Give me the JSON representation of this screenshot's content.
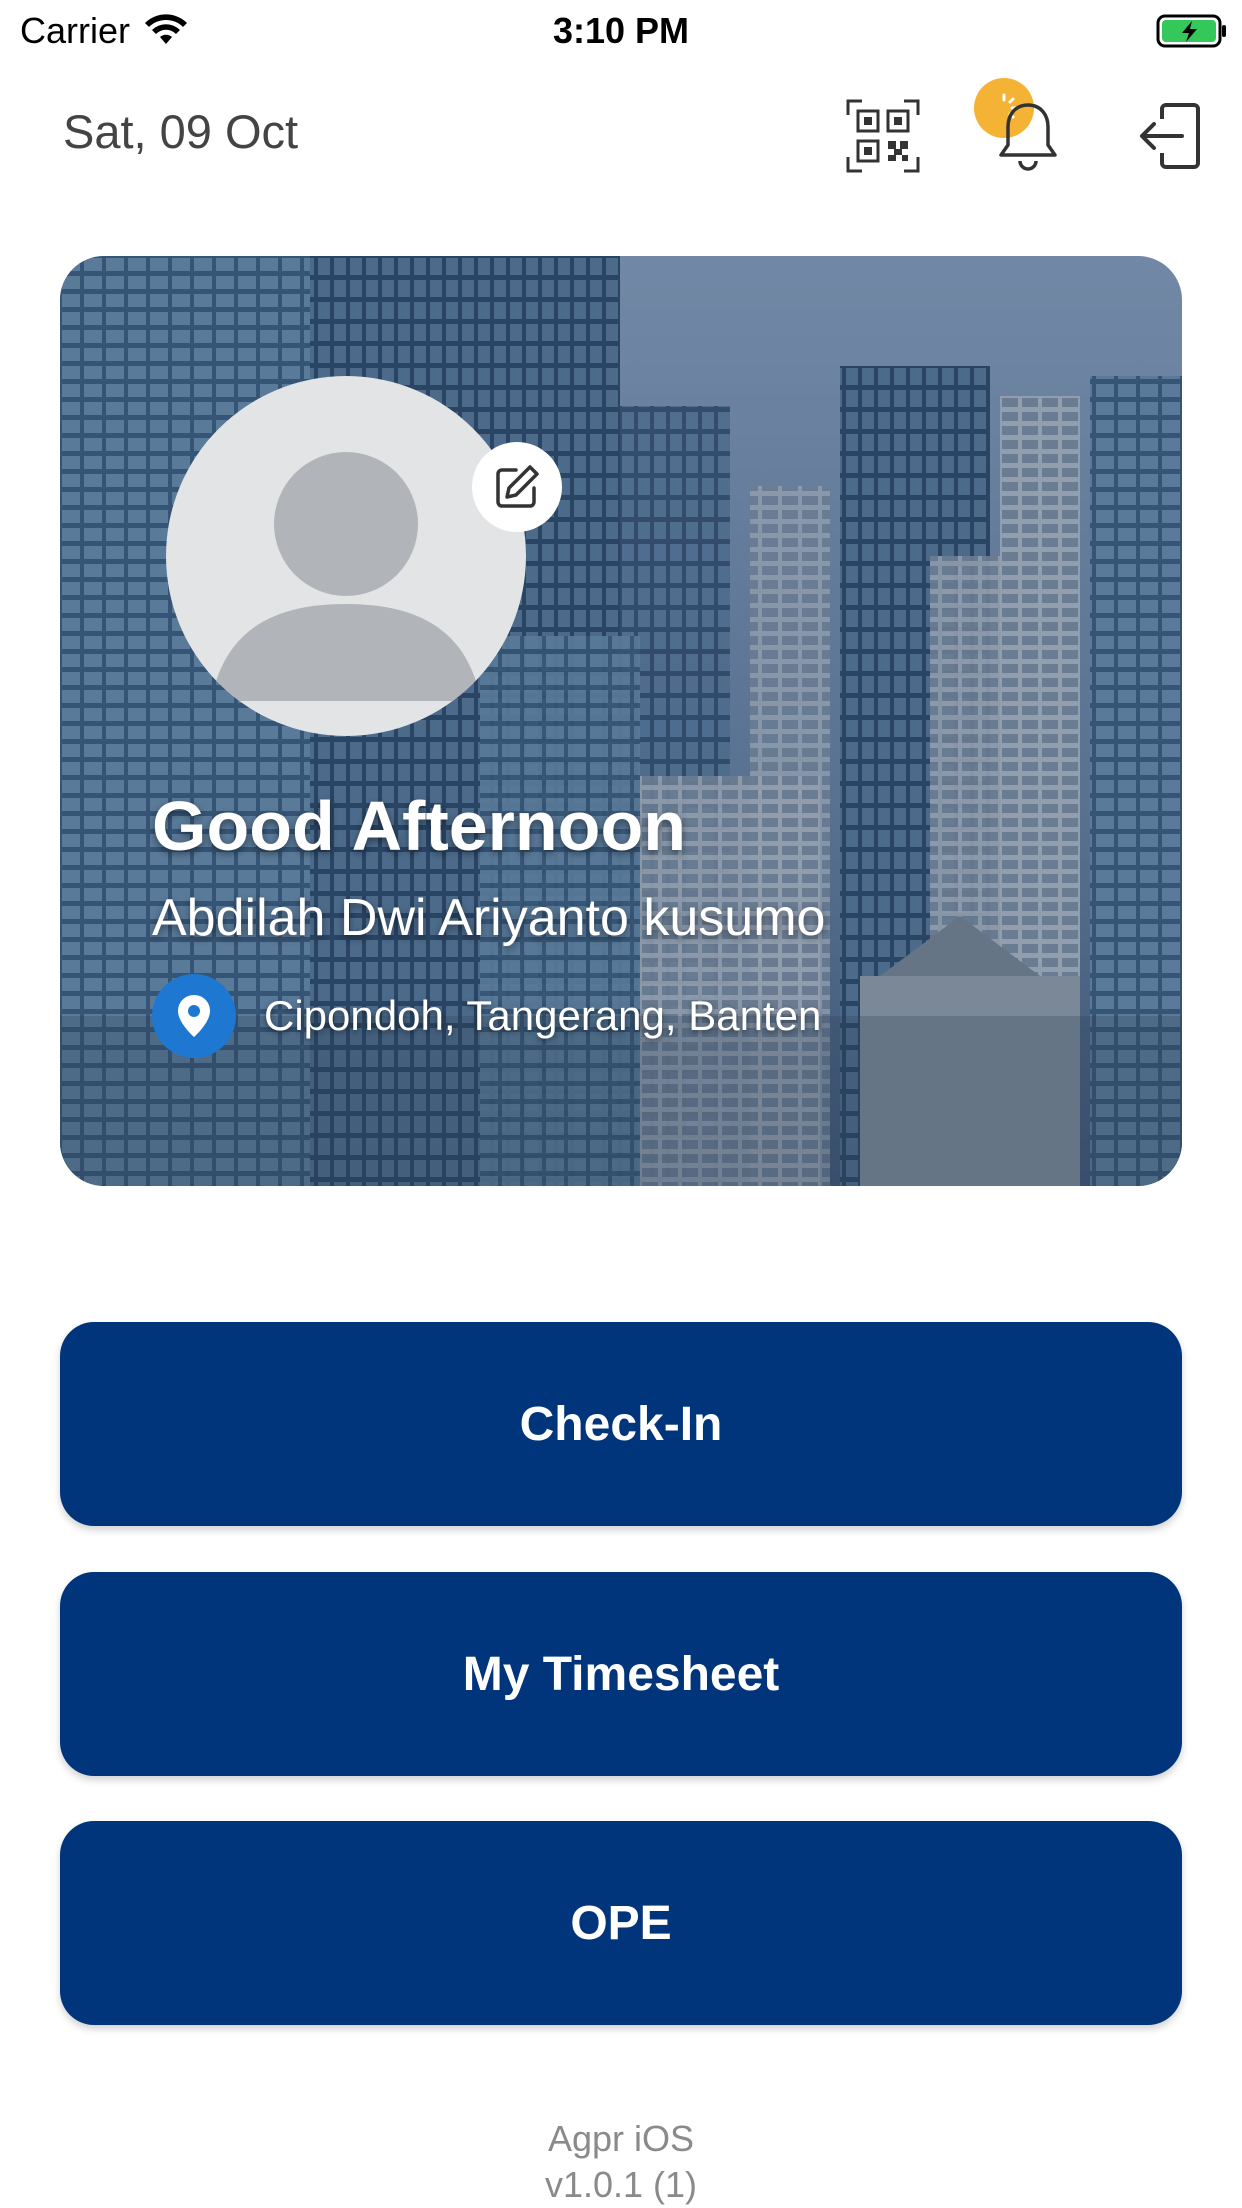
{
  "status_bar": {
    "carrier": "Carrier",
    "time": "3:10 PM",
    "icons": [
      "wifi-icon",
      "battery-charging-icon"
    ]
  },
  "header": {
    "date": "Sat, 09 Oct",
    "icons": [
      "qr-code-icon",
      "bell-icon",
      "logout-icon"
    ],
    "notification_dot_color": "#f5b335"
  },
  "profile_card": {
    "greeting": "Good Afternoon",
    "name": "Abdilah Dwi Ariyanto kusumo",
    "location": "Cipondoh, Tangerang, Banten",
    "avatar_icon": "user-avatar-placeholder-icon",
    "edit_icon": "edit-icon",
    "location_icon": "map-pin-icon",
    "location_pin_color": "#1e78d1"
  },
  "actions": {
    "check_in": "Check-In",
    "timesheet": "My Timesheet",
    "ope": "OPE",
    "button_color": "#00347b"
  },
  "footer": {
    "app_name": "Agpr iOS",
    "version": "v1.0.1 (1)"
  }
}
